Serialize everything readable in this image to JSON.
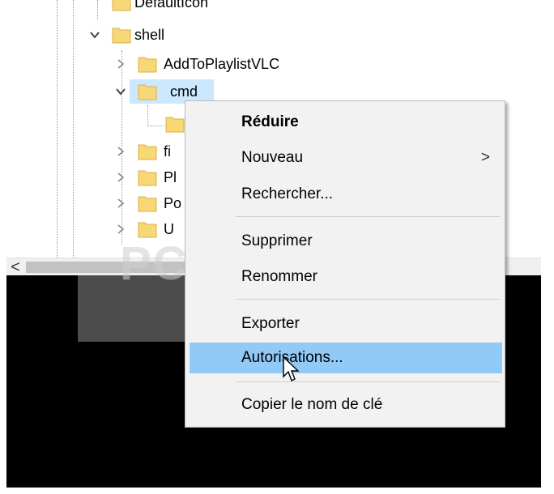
{
  "tree": {
    "top_partial_label": "DefaultIcon",
    "shell_label": "shell",
    "addtoplaylist_label": "AddToPlaylistVLC",
    "cmd_label": "cmd",
    "child_partial_1": "fi",
    "child_partial_2": "Pl",
    "child_partial_3": "Po",
    "child_partial_4": "U"
  },
  "scrollbar": {
    "left_arrow": "<"
  },
  "watermark": {
    "text": "PC ASTUCES"
  },
  "context_menu": {
    "items": [
      {
        "label": "Réduire",
        "bold": true
      },
      {
        "label": "Nouveau",
        "submenu_arrow": ">"
      },
      {
        "label": "Rechercher..."
      },
      {
        "label": "Supprimer"
      },
      {
        "label": "Renommer"
      },
      {
        "label": "Exporter"
      },
      {
        "label": "Autorisations...",
        "highlighted": true
      },
      {
        "label": "Copier le nom de clé"
      }
    ]
  },
  "colors": {
    "selection": "#cce8ff",
    "menu_highlight": "#91c9f7",
    "menu_background": "#f2f2f2",
    "folder": "#f8d775",
    "console_background": "#000000"
  }
}
